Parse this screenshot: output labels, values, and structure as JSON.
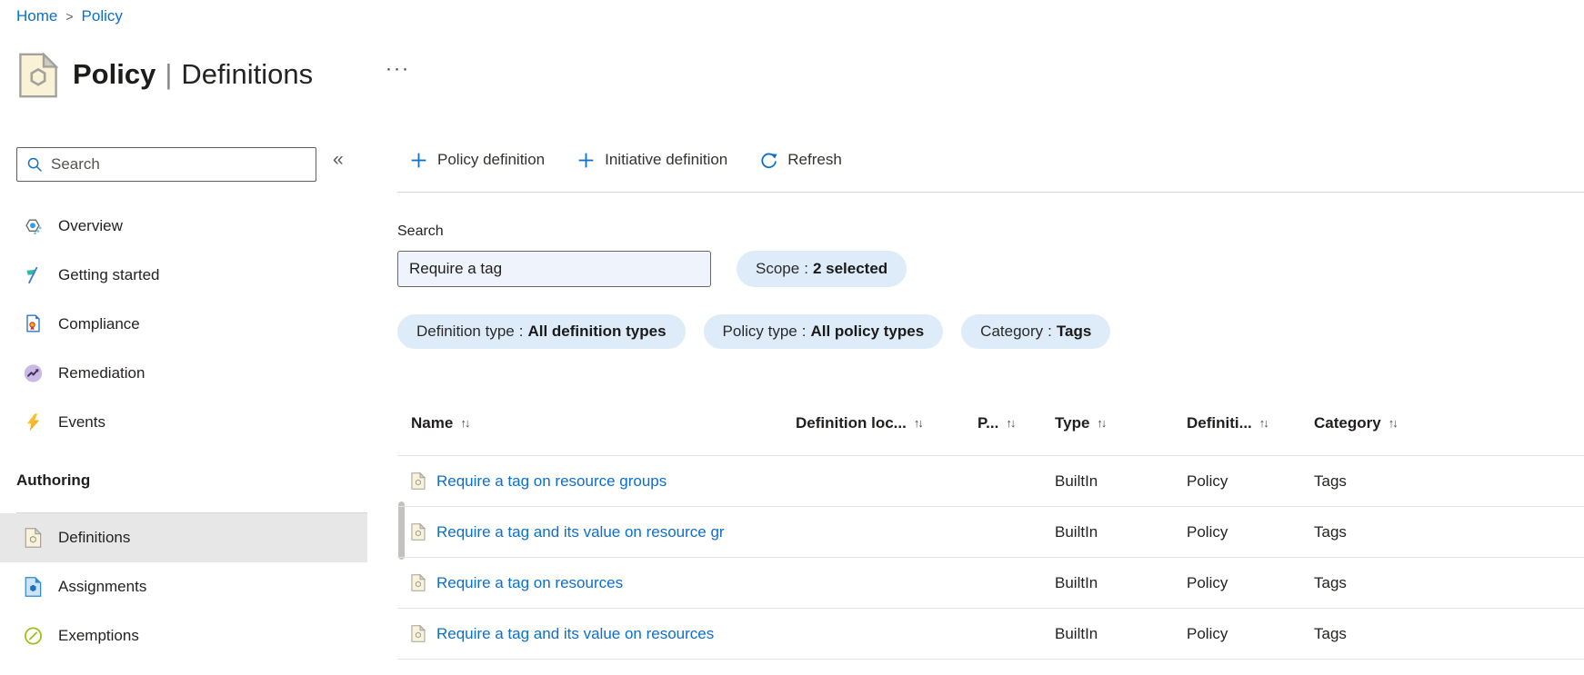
{
  "breadcrumb": {
    "items": [
      "Home",
      "Policy"
    ]
  },
  "header": {
    "title_primary": "Policy",
    "title_separator": "|",
    "title_secondary": "Definitions"
  },
  "sidebar": {
    "search_placeholder": "Search",
    "items": [
      "Overview",
      "Getting started",
      "Compliance",
      "Remediation",
      "Events"
    ],
    "section_title": "Authoring",
    "authoring_items": [
      "Definitions",
      "Assignments",
      "Exemptions"
    ],
    "selected_item": "Definitions"
  },
  "toolbar": {
    "buttons": [
      "Policy definition",
      "Initiative definition",
      "Refresh"
    ]
  },
  "filters": {
    "search_label": "Search",
    "search_value": "Require a tag",
    "pill_separator": ":",
    "scope_pill": {
      "label": "Scope",
      "value": "2 selected"
    },
    "pills": [
      {
        "label": "Definition type",
        "value": "All definition types"
      },
      {
        "label": "Policy type",
        "value": "All policy types"
      },
      {
        "label": "Category",
        "value": "Tags"
      }
    ]
  },
  "table": {
    "columns": [
      "Name",
      "Definition loc...",
      "P...",
      "Type",
      "Definiti...",
      "Category"
    ],
    "rows": [
      {
        "name": "Require a tag on resource groups",
        "definition_location": "",
        "policies": "",
        "type": "BuiltIn",
        "definition_type": "Policy",
        "category": "Tags"
      },
      {
        "name": "Require a tag and its value on resource gr",
        "definition_location": "",
        "policies": "",
        "type": "BuiltIn",
        "definition_type": "Policy",
        "category": "Tags"
      },
      {
        "name": "Require a tag on resources",
        "definition_location": "",
        "policies": "",
        "type": "BuiltIn",
        "definition_type": "Policy",
        "category": "Tags"
      },
      {
        "name": "Require a tag and its value on resources",
        "definition_location": "",
        "policies": "",
        "type": "BuiltIn",
        "definition_type": "Policy",
        "category": "Tags"
      }
    ]
  },
  "icons": {
    "breadcrumb_separator": ">",
    "more_menu": "···",
    "sidebar_collapse": "«",
    "sort": "↑↓"
  },
  "colors": {
    "link_blue": "#0b6fd0",
    "accent_blue": "#0078d4",
    "pill_background": "#deecf9",
    "search_input_background": "#eef3fc",
    "selected_item_background": "#e7e7e7",
    "definitions_icon_cream": "#f9f3da",
    "exemptions_green": "#9bc115",
    "events_orange": "#f59a0c"
  }
}
